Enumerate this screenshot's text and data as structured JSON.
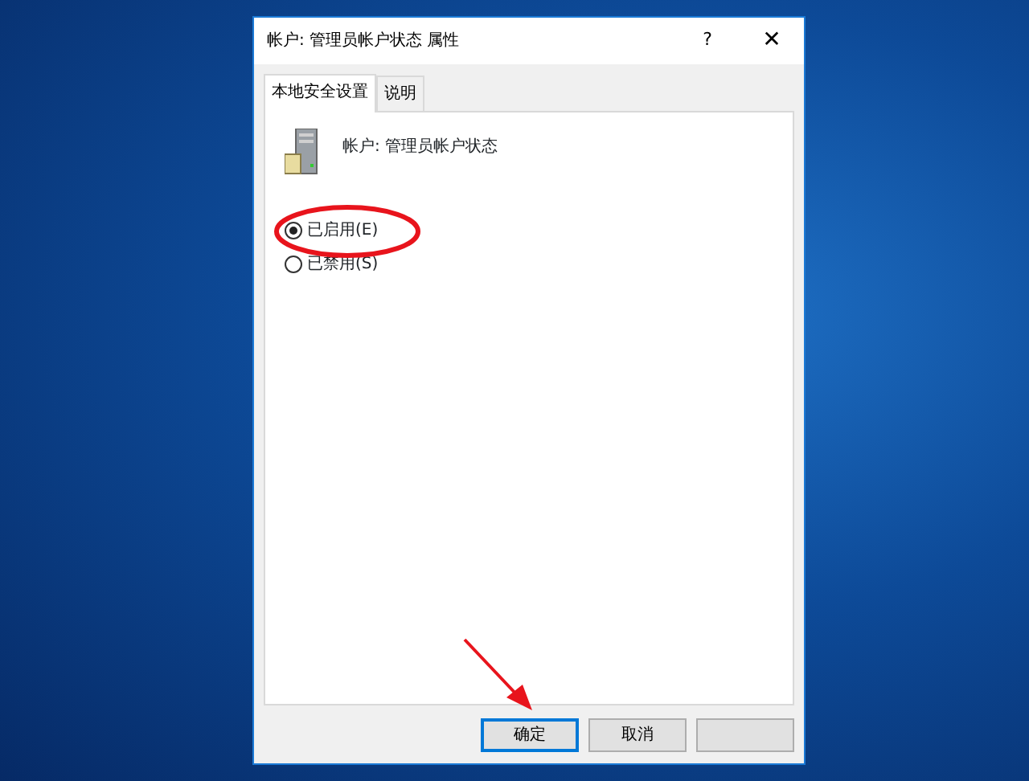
{
  "window": {
    "title": "帐户: 管理员帐户状态 属性"
  },
  "title_buttons": [
    {
      "kind": "help",
      "label": "?"
    },
    {
      "kind": "close",
      "label": "✕"
    }
  ],
  "tabs": [
    {
      "label": "本地安全设置",
      "selected": true
    },
    {
      "label": "说明",
      "selected": false
    }
  ],
  "policy": {
    "name": "帐户: 管理员帐户状态"
  },
  "options": [
    {
      "label": "已启用(E)",
      "selected": true
    },
    {
      "label": "已禁用(S)",
      "selected": false
    }
  ],
  "buttons": [
    {
      "label": "确定",
      "default": true
    },
    {
      "label": "取消",
      "default": false
    }
  ]
}
